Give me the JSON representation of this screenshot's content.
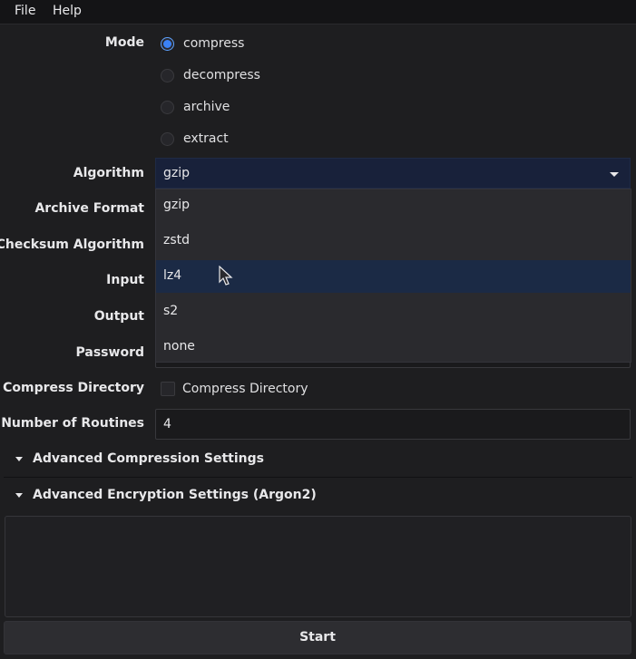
{
  "menu": {
    "file": "File",
    "help": "Help"
  },
  "labels": {
    "mode": "Mode",
    "algorithm": "Algorithm",
    "archive_format": "Archive Format",
    "checksum_algorithm": "Checksum Algorithm",
    "input": "Input",
    "output": "Output",
    "password": "Password",
    "compress_directory": "Compress Directory",
    "number_of_routines": "Number of Routines"
  },
  "mode_options": [
    {
      "label": "compress",
      "selected": true
    },
    {
      "label": "decompress",
      "selected": false
    },
    {
      "label": "archive",
      "selected": false
    },
    {
      "label": "extract",
      "selected": false
    }
  ],
  "algorithm": {
    "selected": "gzip",
    "options": [
      "gzip",
      "zstd",
      "lz4",
      "s2",
      "none"
    ],
    "hovered": "lz4"
  },
  "compress_directory": {
    "label": "Compress Directory",
    "checked": false
  },
  "routines": {
    "value": "4"
  },
  "sections": {
    "compression": "Advanced Compression Settings",
    "encryption": "Advanced Encryption Settings (Argon2)"
  },
  "start_label": "Start",
  "colors": {
    "accent": "#3b82f6",
    "background": "#1e1e20",
    "hover": "#1b2a45"
  }
}
